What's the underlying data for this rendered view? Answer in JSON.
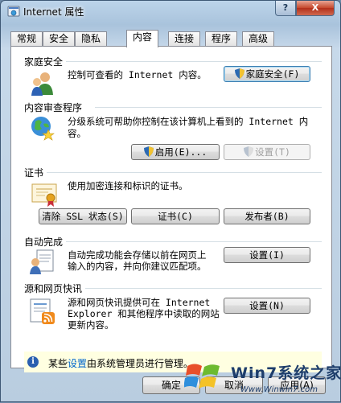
{
  "window": {
    "title": "Internet 属性",
    "help_label": "?",
    "close_label": "X"
  },
  "tabs": [
    {
      "label": "常规"
    },
    {
      "label": "安全"
    },
    {
      "label": "隐私"
    },
    {
      "label": "内容",
      "active": true
    },
    {
      "label": "连接"
    },
    {
      "label": "程序"
    },
    {
      "label": "高级"
    }
  ],
  "family_safety": {
    "title": "家庭安全",
    "description": "控制可查看的 Internet 内容。",
    "button_label": "家庭安全(F)"
  },
  "content_advisor": {
    "title": "内容审查程序",
    "description_line1": "分级系统可帮助你控制在该计算机上看到的 Internet 内",
    "description_line2": "容。",
    "enable_label": "启用(E)...",
    "settings_label": "设置(T)"
  },
  "certificates": {
    "title": "证书",
    "description": "使用加密连接和标识的证书。",
    "clear_ssl_label": "清除 SSL 状态(S)",
    "certificates_label": "证书(C)",
    "publishers_label": "发布者(B)"
  },
  "autocomplete": {
    "title": "自动完成",
    "description_line1": "自动完成功能会存储以前在网页上",
    "description_line2": "输入的内容，并向你建议匹配项。",
    "settings_label": "设置(I)"
  },
  "feeds": {
    "title": "源和网页快讯",
    "description_line1": "源和网页快讯提供可在 Internet",
    "description_line2": "Explorer 和其他程序中读取的网站",
    "description_line3": "更新内容。",
    "settings_label": "设置(N)"
  },
  "info_bar": {
    "text_before": "某些",
    "link_text": "设置",
    "text_after": "由系统管理员进行管理。"
  },
  "footer": {
    "ok_label": "确定",
    "cancel_label": "取消",
    "apply_label": "应用(A)"
  },
  "watermark": {
    "brand": "Win7系统之家",
    "url": "Www.Winwin7.com"
  }
}
